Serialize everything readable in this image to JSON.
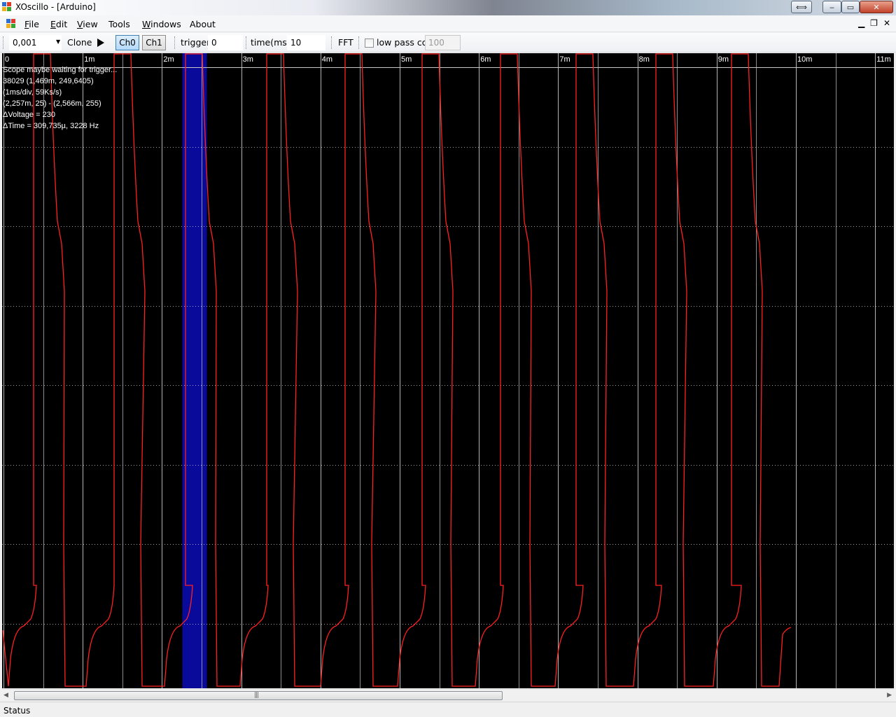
{
  "window": {
    "title": "XOscillo - [Arduino]"
  },
  "menu": {
    "items": [
      {
        "label": "File",
        "underline": "F",
        "rest": "ile"
      },
      {
        "label": "Edit",
        "underline": "E",
        "rest": "dit"
      },
      {
        "label": "View",
        "underline": "V",
        "rest": "iew"
      },
      {
        "label": "Tools",
        "underline": "",
        "rest": "Tools"
      },
      {
        "label": "Windows",
        "underline": "W",
        "rest": "indows"
      },
      {
        "label": "About",
        "underline": "",
        "rest": "About"
      }
    ]
  },
  "toolbar": {
    "zoom_value": "0,001",
    "clone_label": "Clone",
    "ch0_label": "Ch0",
    "ch1_label": "Ch1",
    "trigger_label": "trigger",
    "trigger_value": "0",
    "time_label": "time(ms)",
    "time_value": "10",
    "fft_label": "FFT",
    "lowpass_label": "low pass cof",
    "lowpass_value": "100"
  },
  "scope": {
    "time_ticks": [
      "0",
      "1m",
      "2m",
      "3m",
      "4m",
      "5m",
      "6m",
      "7m",
      "8m",
      "9m",
      "10m",
      "11m"
    ],
    "info": {
      "line1": "Scope maybe waiting for trigger...",
      "line2": "38029 (1,469m, 249,6405)",
      "line3": "(1ms/div, 59Ks/s)",
      "line4": "(2,257m, 25) - (2,566m, 255)",
      "line5": "ΔVoltage = 230",
      "line6": "ΔTime = 309,735µ, 3228 Hz"
    },
    "colors": {
      "background": "#000000",
      "trace": "#ff2020",
      "grid": "#c8c8c8",
      "selection": "#0a0a9a",
      "text": "#ffffff"
    },
    "selection_ms": [
      2.257,
      2.566
    ],
    "y_range": [
      0,
      255
    ]
  },
  "status": {
    "text": "Status"
  }
}
